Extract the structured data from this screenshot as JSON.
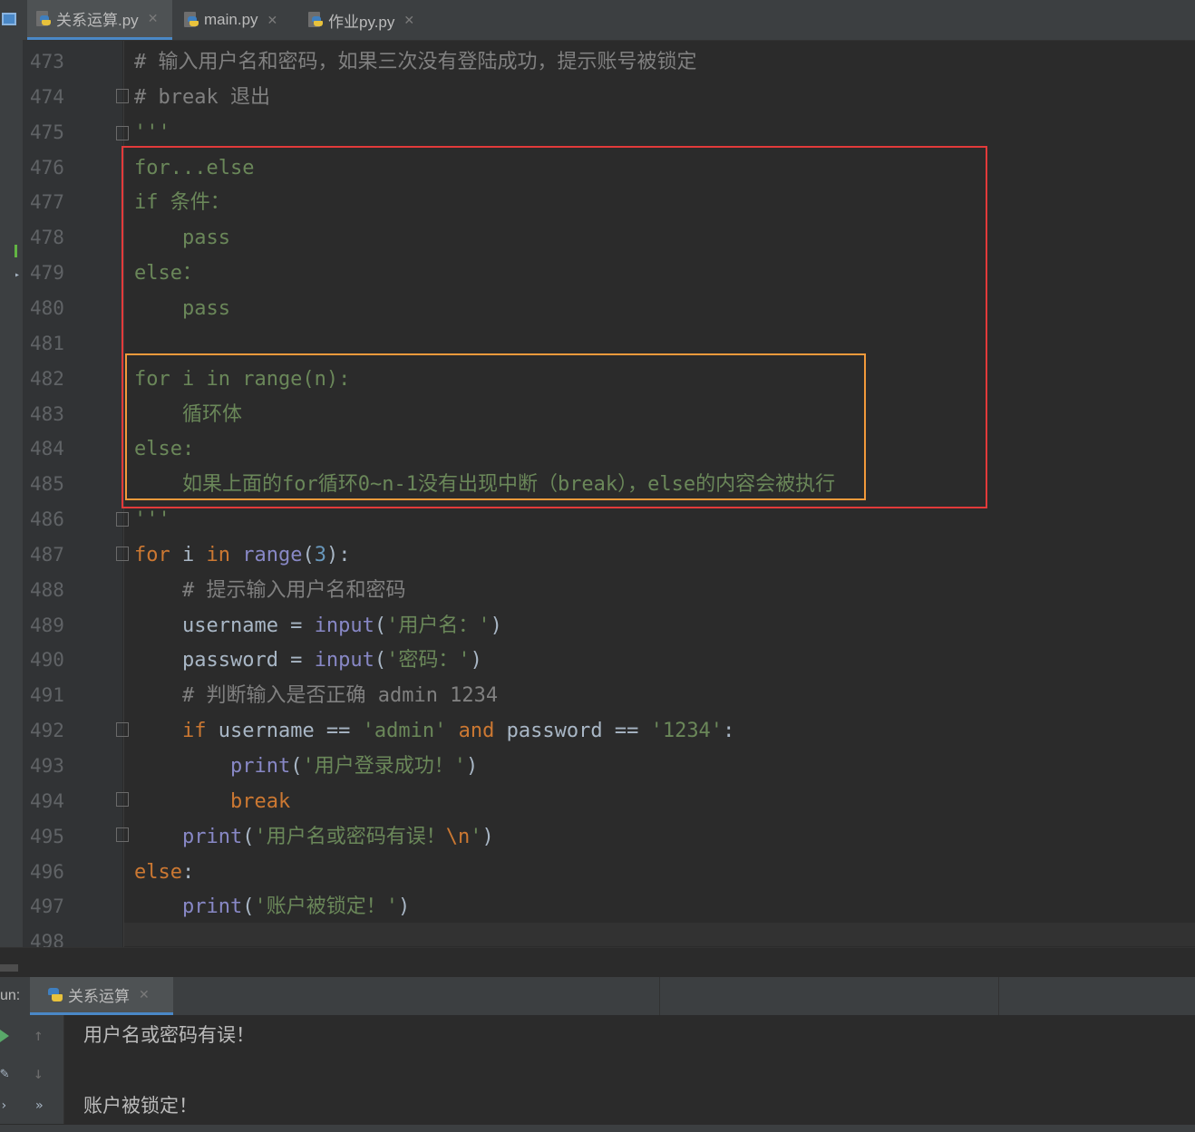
{
  "tabs": [
    {
      "label": "关系运算.py",
      "active": true
    },
    {
      "label": "main.py",
      "active": false
    },
    {
      "label": "作业py.py",
      "active": false
    }
  ],
  "lines": [
    {
      "n": "473",
      "seg": [
        {
          "t": "# 输入用户名和密码，如果三次没有登陆成功，提示账号被锁定",
          "c": "com"
        }
      ]
    },
    {
      "n": "474",
      "seg": [
        {
          "t": "# break 退出",
          "c": "com"
        }
      ]
    },
    {
      "n": "475",
      "seg": [
        {
          "t": "'''",
          "c": "str"
        }
      ]
    },
    {
      "n": "476",
      "seg": [
        {
          "t": "for...else",
          "c": "str"
        }
      ]
    },
    {
      "n": "477",
      "seg": [
        {
          "t": "if 条件：",
          "c": "str"
        }
      ]
    },
    {
      "n": "478",
      "seg": [
        {
          "t": "    pass",
          "c": "str"
        }
      ]
    },
    {
      "n": "479",
      "seg": [
        {
          "t": "else：",
          "c": "str"
        }
      ]
    },
    {
      "n": "480",
      "seg": [
        {
          "t": "    pass",
          "c": "str"
        }
      ]
    },
    {
      "n": "481",
      "seg": []
    },
    {
      "n": "482",
      "seg": [
        {
          "t": "for i in range(n):",
          "c": "str"
        }
      ]
    },
    {
      "n": "483",
      "seg": [
        {
          "t": "    循环体",
          "c": "str"
        }
      ]
    },
    {
      "n": "484",
      "seg": [
        {
          "t": "else:",
          "c": "str"
        }
      ]
    },
    {
      "n": "485",
      "seg": [
        {
          "t": "    如果上面的for循环0~n-1没有出现中断（break），else的内容会被执行",
          "c": "str"
        }
      ]
    },
    {
      "n": "486",
      "seg": [
        {
          "t": "'''",
          "c": "str"
        }
      ]
    },
    {
      "n": "487",
      "seg": [
        {
          "t": "for",
          "c": "kw"
        },
        {
          "t": " i ",
          "c": "txt"
        },
        {
          "t": "in",
          "c": "kw"
        },
        {
          "t": " ",
          "c": "txt"
        },
        {
          "t": "range",
          "c": "fn"
        },
        {
          "t": "(",
          "c": "txt"
        },
        {
          "t": "3",
          "c": "num"
        },
        {
          "t": "):",
          "c": "txt"
        }
      ]
    },
    {
      "n": "488",
      "seg": [
        {
          "t": "    # 提示输入用户名和密码",
          "c": "com"
        }
      ]
    },
    {
      "n": "489",
      "seg": [
        {
          "t": "    username = ",
          "c": "txt"
        },
        {
          "t": "input",
          "c": "fn"
        },
        {
          "t": "(",
          "c": "txt"
        },
        {
          "t": "'用户名：'",
          "c": "str"
        },
        {
          "t": ")",
          "c": "txt"
        }
      ]
    },
    {
      "n": "490",
      "seg": [
        {
          "t": "    password = ",
          "c": "txt"
        },
        {
          "t": "input",
          "c": "fn"
        },
        {
          "t": "(",
          "c": "txt"
        },
        {
          "t": "'密码：'",
          "c": "str"
        },
        {
          "t": ")",
          "c": "txt"
        }
      ]
    },
    {
      "n": "491",
      "seg": [
        {
          "t": "    # 判断输入是否正确 admin 1234",
          "c": "com"
        }
      ]
    },
    {
      "n": "492",
      "seg": [
        {
          "t": "    ",
          "c": "txt"
        },
        {
          "t": "if",
          "c": "kw"
        },
        {
          "t": " username == ",
          "c": "txt"
        },
        {
          "t": "'admin'",
          "c": "str"
        },
        {
          "t": " ",
          "c": "txt"
        },
        {
          "t": "and",
          "c": "kw"
        },
        {
          "t": " password == ",
          "c": "txt"
        },
        {
          "t": "'1234'",
          "c": "str"
        },
        {
          "t": ":",
          "c": "txt"
        }
      ]
    },
    {
      "n": "493",
      "seg": [
        {
          "t": "        ",
          "c": "txt"
        },
        {
          "t": "print",
          "c": "fn"
        },
        {
          "t": "(",
          "c": "txt"
        },
        {
          "t": "'用户登录成功！'",
          "c": "str"
        },
        {
          "t": ")",
          "c": "txt"
        }
      ]
    },
    {
      "n": "494",
      "seg": [
        {
          "t": "        ",
          "c": "txt"
        },
        {
          "t": "break",
          "c": "kw"
        }
      ]
    },
    {
      "n": "495",
      "seg": [
        {
          "t": "    ",
          "c": "txt"
        },
        {
          "t": "print",
          "c": "fn"
        },
        {
          "t": "(",
          "c": "txt"
        },
        {
          "t": "'用户名或密码有误！",
          "c": "str"
        },
        {
          "t": "\\n",
          "c": "kw"
        },
        {
          "t": "'",
          "c": "str"
        },
        {
          "t": ")",
          "c": "txt"
        }
      ]
    },
    {
      "n": "496",
      "seg": [
        {
          "t": "else",
          "c": "kw"
        },
        {
          "t": ":",
          "c": "txt"
        }
      ]
    },
    {
      "n": "497",
      "seg": [
        {
          "t": "    ",
          "c": "txt"
        },
        {
          "t": "print",
          "c": "fn"
        },
        {
          "t": "(",
          "c": "txt"
        },
        {
          "t": "'账户被锁定！'",
          "c": "str"
        },
        {
          "t": ")",
          "c": "txt"
        }
      ]
    },
    {
      "n": "498",
      "seg": []
    }
  ],
  "run_panel": {
    "label": "un:",
    "tab_label": "关系运算",
    "output": [
      "用户名或密码有误！",
      "",
      "账户被锁定！"
    ]
  },
  "colors": {
    "comment": "#808080",
    "string": "#6a8759",
    "keyword": "#cc7832",
    "builtin": "#8888c6",
    "number": "#6897bb",
    "text": "#a9b7c6",
    "highlight_outer": "#e23a3a",
    "highlight_inner": "#f29a3b"
  }
}
